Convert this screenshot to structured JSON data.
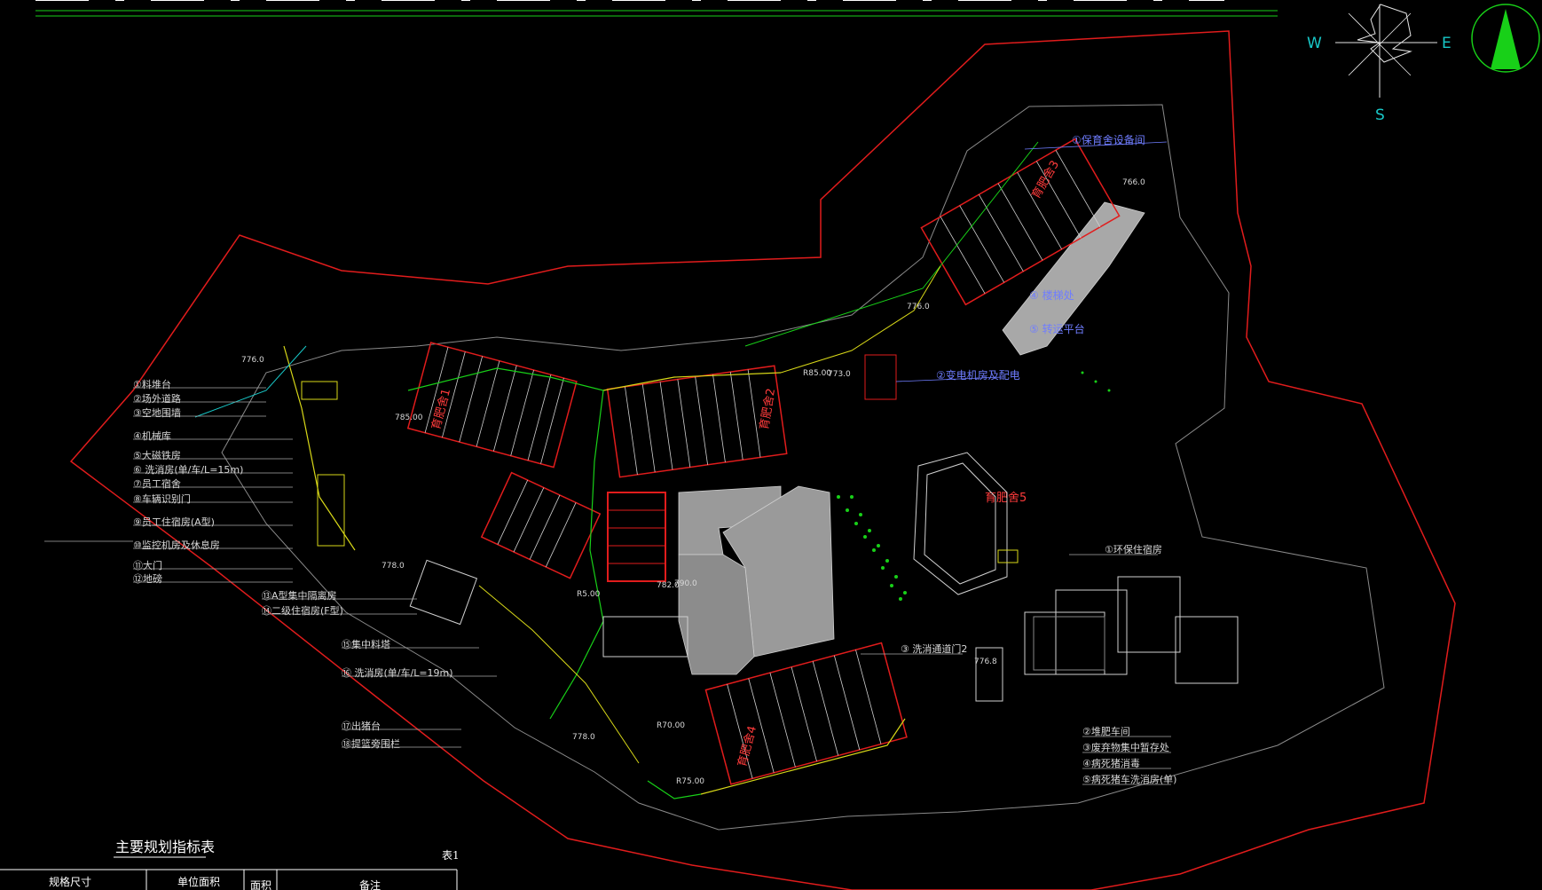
{
  "compass": {
    "west": "W",
    "east": "E",
    "south": "S"
  },
  "table": {
    "title": "主要规划指标表",
    "tag": "表1",
    "headers": [
      "规格尺寸",
      "单位面积",
      "面积",
      "备注"
    ]
  },
  "left_labels": [
    "①料堆台",
    "②场外道路",
    "③空地围墙",
    "④机械库",
    "⑤大磁铁房",
    "⑥ 洗消房(单/车/L=15m)",
    "⑦员工宿舍",
    "⑧车辆识别门",
    "⑨员工住宿房(A型)",
    "⑩监控机房及休息房",
    "⑪大门",
    "⑫地磅"
  ],
  "mid_labels": [
    "⑬A型集中隔离房",
    "⑭二级住宿房(F型)",
    "⑮集中料塔",
    "⑯ 洗消房(单/车/L=19m)",
    "⑰出猪台",
    "⑱提篮旁围栏"
  ],
  "right_labels": [
    "①环保住宿房",
    "②堆肥车间",
    "③废弃物集中暂存处",
    "④病死猪消毒",
    "⑤病死猪车洗消房(单)"
  ],
  "blue_labels": [
    "①保育舍设备间",
    "②变电机房及配电",
    "③ 洗消通道门2",
    "④ 楼梯处",
    "⑤ 转运平台"
  ],
  "barn_labels": [
    "育肥舍1",
    "育肥舍2",
    "育肥舍3",
    "育肥舍4",
    "育肥舍5"
  ],
  "level_marks": [
    "776.0",
    "778.0",
    "773.0",
    "785.00",
    "R85.00",
    "790.0",
    "R5.00",
    "776.8",
    "R70.00",
    "766.0",
    "778.0",
    "782.0",
    "R75.00",
    "776.0"
  ]
}
